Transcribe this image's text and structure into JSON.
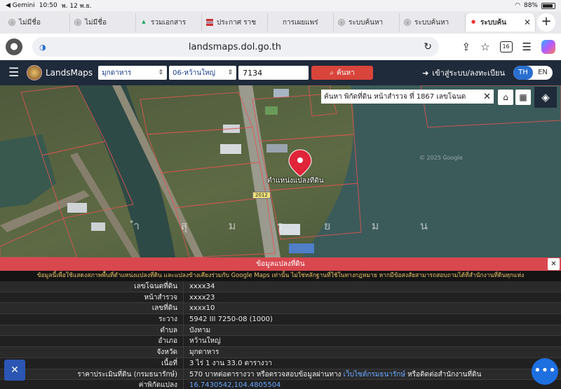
{
  "status": {
    "carrier": "◀ Gemini",
    "time": "10:50",
    "date": "พ. 12 พ.ย.",
    "battery": "88%"
  },
  "tabs": [
    {
      "label": "ไม่มีชื่อ",
      "icon": "globe-icon"
    },
    {
      "label": "ไม่มีชื่อ",
      "icon": "globe-icon"
    },
    {
      "label": "รวมเอกสาร",
      "icon": "drive-icon"
    },
    {
      "label": "ประกาศ ราช",
      "icon": "flag-icon"
    },
    {
      "label": "การเผยแพร่",
      "icon": "apple-icon"
    },
    {
      "label": "ระบบค้นหา",
      "icon": "globe-icon"
    },
    {
      "label": "ระบบค้นหา",
      "icon": "globe-icon"
    },
    {
      "label": "ระบบค้น",
      "icon": "map-pin-icon"
    }
  ],
  "address": {
    "url": "landsmaps.dol.go.th",
    "tab_count": "16"
  },
  "app": {
    "brand": "LandsMaps",
    "province": "มุกดาหาร",
    "district": "06-หว้านใหญ่",
    "parcel_input": "7134",
    "search_label": "ค้นหา",
    "login_label": "เข้าสู่ระบบ/ลงทะเบียน",
    "lang_th": "TH",
    "lang_en": "EN"
  },
  "map": {
    "search_text": "ค้นหา พิกัดที่ดิน  หน้าสำรวจ  ที่ 1867 เลขโฉนด",
    "pin_label": "ตำแหน่งแปลงที่ดิน",
    "road_label": "2012",
    "river_letters": [
      "ำ",
      "สุ",
      "ม",
      "ร",
      "ย",
      "ม",
      "น"
    ],
    "watermark": "© 2025 Google"
  },
  "panel": {
    "title": "ข้อมูลแปลงที่ดิน",
    "notice": "ข้อมูลนี้เพื่อใช้แสดงสภาพพื้นที่ตำแหน่งแปลงที่ดิน และแปลงข้างเคียงร่วมกับ Google Maps เท่านั้น ไม่ใช่หลักฐานที่ใช้ในทางกฎหมาย หากมีข้อสงสัยสามารถสอบถามได้ที่สำนักงานที่ดินทุกแห่ง",
    "rows": [
      {
        "k": "เลขโฉนดที่ดิน",
        "v": "xxxx34"
      },
      {
        "k": "หน้าสำรวจ",
        "v": "xxxx23"
      },
      {
        "k": "เลขที่ดิน",
        "v": "xxxx10"
      },
      {
        "k": "ระวาง",
        "v": "5942 III 7250-08 (1000)"
      },
      {
        "k": "ตำบล",
        "v": "บังทาม"
      },
      {
        "k": "อำเภอ",
        "v": "หว้านใหญ่"
      },
      {
        "k": "จังหวัด",
        "v": "มุกดาหาร"
      },
      {
        "k": "เนื้อที่",
        "v": "3 ไร่ 1 งาน 33.0 ตารางวา"
      }
    ],
    "price": {
      "k": "ราคาประเมินที่ดิน (กรมธนารักษ์)",
      "v1": "570 บาทต่อตารางวา หรือตรวจสอบข้อมูลผ่านทาง ",
      "link": "เว็บไซต์กรมธนารักษ์",
      "v2": " หรือติดต่อสำนักงานที่ดิน"
    },
    "coord": {
      "k": "ค่าพิกัดแปลง",
      "v": "16.7430542,104.4805504"
    }
  }
}
